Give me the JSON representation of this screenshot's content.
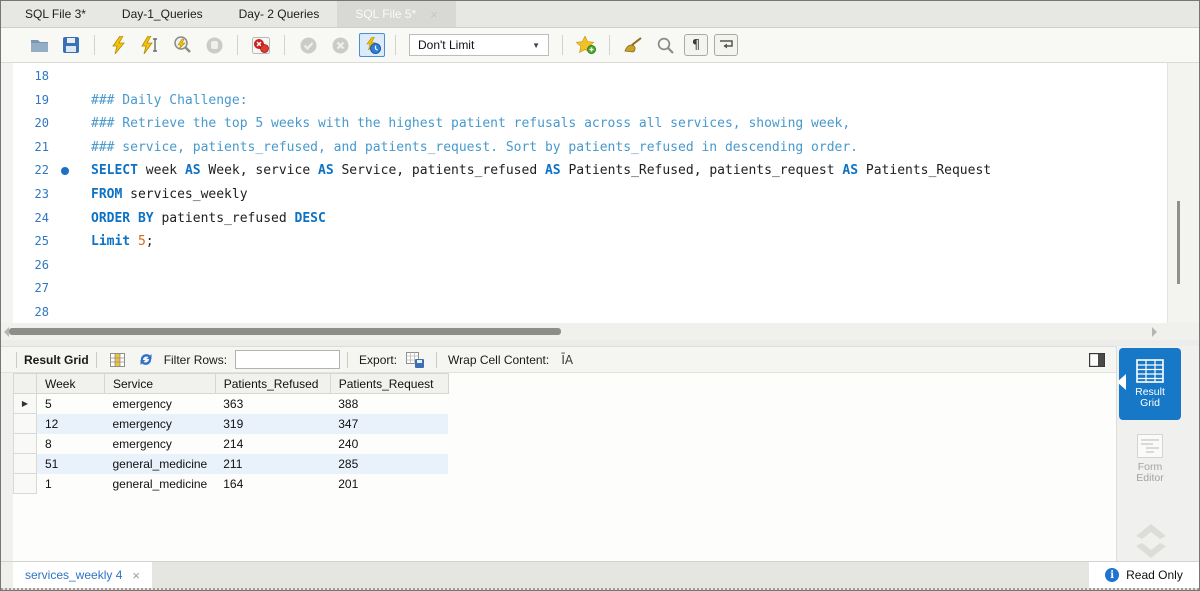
{
  "tabs": [
    {
      "label": "SQL File 3*",
      "active": false
    },
    {
      "label": "Day-1_Queries",
      "active": false
    },
    {
      "label": "Day- 2 Queries",
      "active": false
    },
    {
      "label": "SQL File 5*",
      "active": true
    }
  ],
  "toolbar": {
    "limit_value": "Don't Limit",
    "icons": [
      "open-file",
      "save",
      "execute-script",
      "execute-current-statement",
      "explain-query",
      "stop-query",
      "kill-query",
      "commit",
      "rollback",
      "toggle-autocommit",
      "save-snippet",
      "beautify-script",
      "find",
      "show-invisibles",
      "toggle-wrap"
    ],
    "pilcrow_glyph": "¶",
    "wrap_glyph": "⇥"
  },
  "editor": {
    "lines": [
      {
        "num": "18",
        "tokens": []
      },
      {
        "num": "19",
        "tokens": [
          {
            "c": "cm",
            "t": "### Daily Challenge:"
          }
        ]
      },
      {
        "num": "20",
        "tokens": [
          {
            "c": "cm",
            "t": "### Retrieve the top 5 weeks with the highest patient refusals across all services, showing week,"
          }
        ]
      },
      {
        "num": "21",
        "tokens": [
          {
            "c": "cm",
            "t": "### service, patients_refused, and patients_request. Sort by patients_refused in descending order."
          }
        ]
      },
      {
        "num": "22",
        "marker": true,
        "tokens": [
          {
            "c": "kw",
            "t": "SELECT"
          },
          {
            "c": "pl",
            "t": " week "
          },
          {
            "c": "kw",
            "t": "AS"
          },
          {
            "c": "pl",
            "t": " Week, service "
          },
          {
            "c": "kw",
            "t": "AS"
          },
          {
            "c": "pl",
            "t": " Service, patients_refused "
          },
          {
            "c": "kw",
            "t": "AS"
          },
          {
            "c": "pl",
            "t": " Patients_Refused, patients_request "
          },
          {
            "c": "kw",
            "t": "AS"
          },
          {
            "c": "pl",
            "t": " Patients_Request"
          }
        ]
      },
      {
        "num": "23",
        "tokens": [
          {
            "c": "kw",
            "t": "FROM"
          },
          {
            "c": "pl",
            "t": " services_weekly"
          }
        ]
      },
      {
        "num": "24",
        "tokens": [
          {
            "c": "kw",
            "t": "ORDER BY"
          },
          {
            "c": "pl",
            "t": " patients_refused "
          },
          {
            "c": "kw",
            "t": "DESC"
          }
        ]
      },
      {
        "num": "25",
        "tokens": [
          {
            "c": "kw",
            "t": "Limit"
          },
          {
            "c": "pl",
            "t": " "
          },
          {
            "c": "nm",
            "t": "5"
          },
          {
            "c": "pl",
            "t": ";"
          }
        ]
      },
      {
        "num": "26",
        "tokens": []
      },
      {
        "num": "27",
        "tokens": []
      },
      {
        "num": "28",
        "tokens": []
      }
    ]
  },
  "result_toolbar": {
    "title": "Result Grid",
    "filter_label": "Filter Rows:",
    "filter_value": "",
    "export_label": "Export:",
    "wrap_label": "Wrap Cell Content:",
    "wrap_icon_glyph": "ĪA"
  },
  "result_grid": {
    "columns": [
      "Week",
      "Service",
      "Patients_Refused",
      "Patients_Request"
    ],
    "rows": [
      [
        "5",
        "emergency",
        "363",
        "388"
      ],
      [
        "12",
        "emergency",
        "319",
        "347"
      ],
      [
        "8",
        "emergency",
        "214",
        "240"
      ],
      [
        "51",
        "general_medicine",
        "211",
        "285"
      ],
      [
        "1",
        "general_medicine",
        "164",
        "201"
      ]
    ],
    "selected_row": 0,
    "selected_marker": "▶"
  },
  "sidebar": {
    "result_grid": "Result Grid",
    "form_editor": "Form Editor"
  },
  "statusbar": {
    "result_tab": "services_weekly 4",
    "read_only": "Read Only"
  },
  "colors": {
    "accent_blue": "#1778c8",
    "keyword": "#0d72c4",
    "comment": "#4899cc",
    "number_literal": "#d2691e",
    "line_number": "#2f77c2",
    "row_alt": "#e9f1fb"
  }
}
